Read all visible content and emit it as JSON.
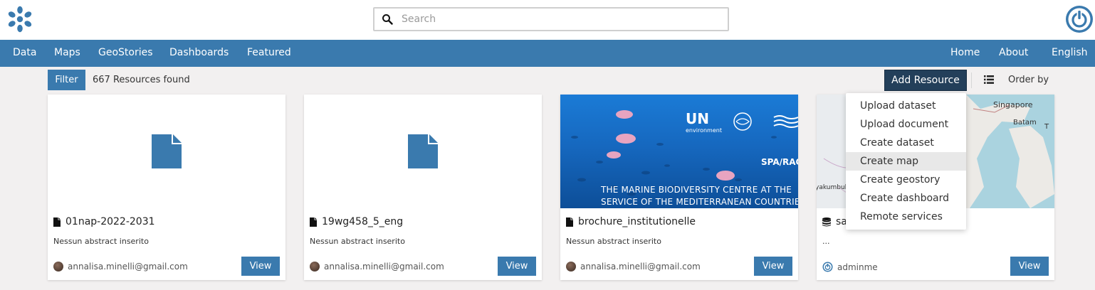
{
  "header": {
    "logo_icon": "geonode-logo-icon",
    "search": {
      "placeholder": "Search",
      "value": ""
    },
    "user_icon": "power-user-icon",
    "accent_color": "#3a7aae"
  },
  "nav": {
    "left": [
      "Data",
      "Maps",
      "GeoStories",
      "Dashboards",
      "Featured"
    ],
    "right": [
      "Home",
      "About",
      "English"
    ]
  },
  "toolbar": {
    "filter_label": "Filter",
    "resources_found": "667 Resources found",
    "add_resource_label": "Add Resource",
    "list_view_icon": "list-icon",
    "order_by_label": "Order by"
  },
  "add_menu": {
    "items": [
      "Upload dataset",
      "Upload document",
      "Create dataset",
      "Create map",
      "Create geostory",
      "Create dashboard",
      "Remote services"
    ],
    "highlighted": "Create map"
  },
  "cards": [
    {
      "title": "01nap-2022-2031",
      "type_icon": "document-icon",
      "abstract": "Nessun abstract inserito",
      "owner": "annalisa.minelli@gmail.com",
      "view_label": "View"
    },
    {
      "title": "19wg458_5_eng",
      "type_icon": "document-icon",
      "abstract": "Nessun abstract inserito",
      "owner": "annalisa.minelli@gmail.com",
      "view_label": "View"
    },
    {
      "title": "brochure_institutionelle",
      "type_icon": "document-icon",
      "abstract": "Nessun abstract inserito",
      "owner": "annalisa.minelli@gmail.com",
      "view_label": "View",
      "thumbnail": {
        "brand": "UN",
        "brand_sub": "environment",
        "partner": "SPA/RAC",
        "line1": "THE MARINE BIODIVERSITY CENTRE AT THE",
        "line2": "SERVICE OF THE MEDITERRANEAN COUNTRIES"
      }
    },
    {
      "title": "sa",
      "type_icon": "database-icon",
      "abstract": "...",
      "owner": "adminme",
      "view_label": "View",
      "thumbnail": {
        "city1": "Singapore",
        "city2": "Batam",
        "city3": "yakumbul",
        "city4": "T"
      }
    }
  ]
}
